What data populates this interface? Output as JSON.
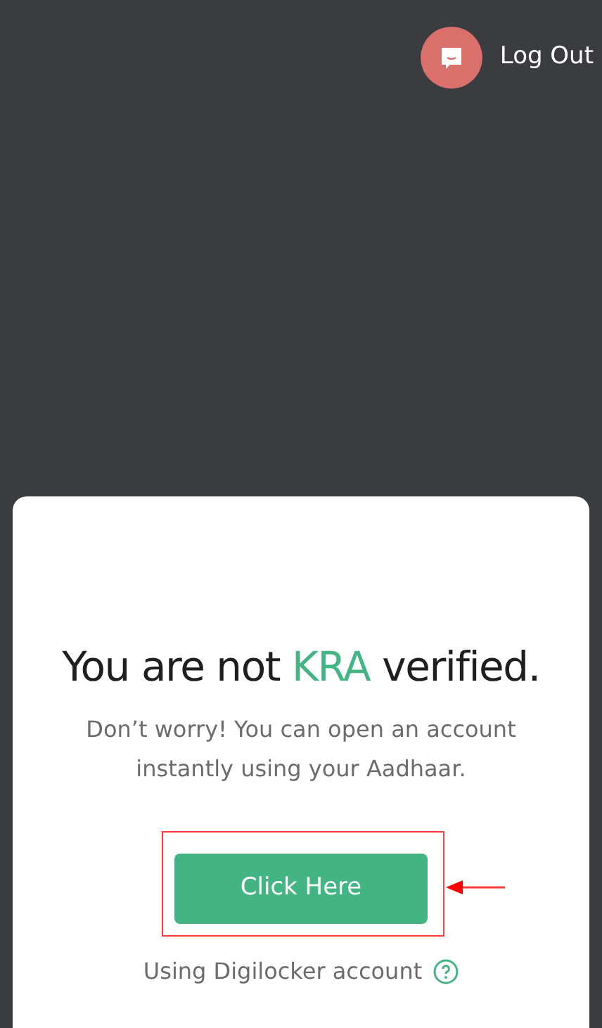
{
  "header": {
    "logout_label": "Log Out"
  },
  "card": {
    "title_parts": [
      {
        "text": "You are not ",
        "highlight": false
      },
      {
        "text": "KRA",
        "highlight": true
      },
      {
        "text": " verified.",
        "highlight": false
      }
    ],
    "message": "Don’t worry! You can open an account instantly using your Aadhaar.",
    "button": "Click Here",
    "note": "Using Digilocker account"
  }
}
